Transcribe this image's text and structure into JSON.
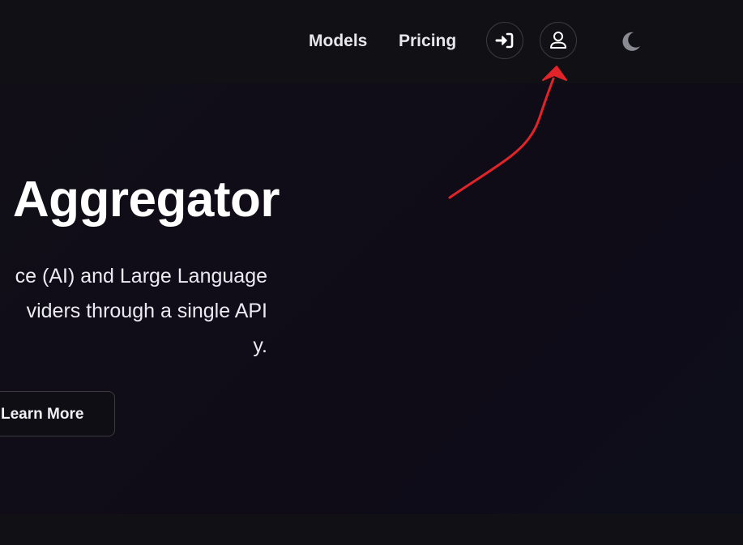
{
  "nav": {
    "links": [
      {
        "label": "Models"
      },
      {
        "label": "Pricing"
      }
    ],
    "icons": {
      "login": "sign-in-icon",
      "account": "user-icon",
      "theme": "moon-icon"
    }
  },
  "hero": {
    "title": "Aggregator",
    "description_lines": [
      "ce (AI) and Large Language",
      "viders through a single API",
      "y."
    ],
    "cta_label": "Learn More"
  },
  "annotation": {
    "type": "arrow",
    "color": "#e0242a",
    "points_to": "account-button"
  },
  "colors": {
    "background": "#0f0d13",
    "navbar": "#111014",
    "text": "#ffffff"
  }
}
